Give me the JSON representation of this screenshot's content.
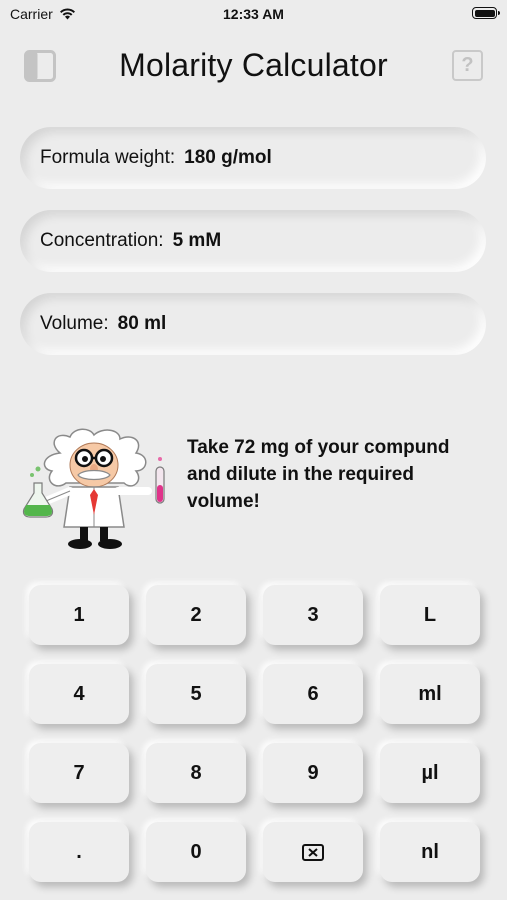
{
  "status_bar": {
    "carrier": "Carrier",
    "time": "12:33 AM"
  },
  "header": {
    "title": "Molarity Calculator",
    "help": "?"
  },
  "fields": [
    {
      "label": "Formula weight:",
      "value": "180 g/mol"
    },
    {
      "label": "Concentration:",
      "value": "5 mM"
    },
    {
      "label": "Volume:",
      "value": "80 ml"
    }
  ],
  "message": "Take 72 mg of your compund and dilute in the required volume!",
  "keypad": {
    "row1": [
      "1",
      "2",
      "3",
      "L"
    ],
    "row2": [
      "4",
      "5",
      "6",
      "ml"
    ],
    "row3": [
      "7",
      "8",
      "9",
      "µl"
    ],
    "row4": [
      ".",
      "0",
      "backspace-icon",
      "nl"
    ]
  }
}
